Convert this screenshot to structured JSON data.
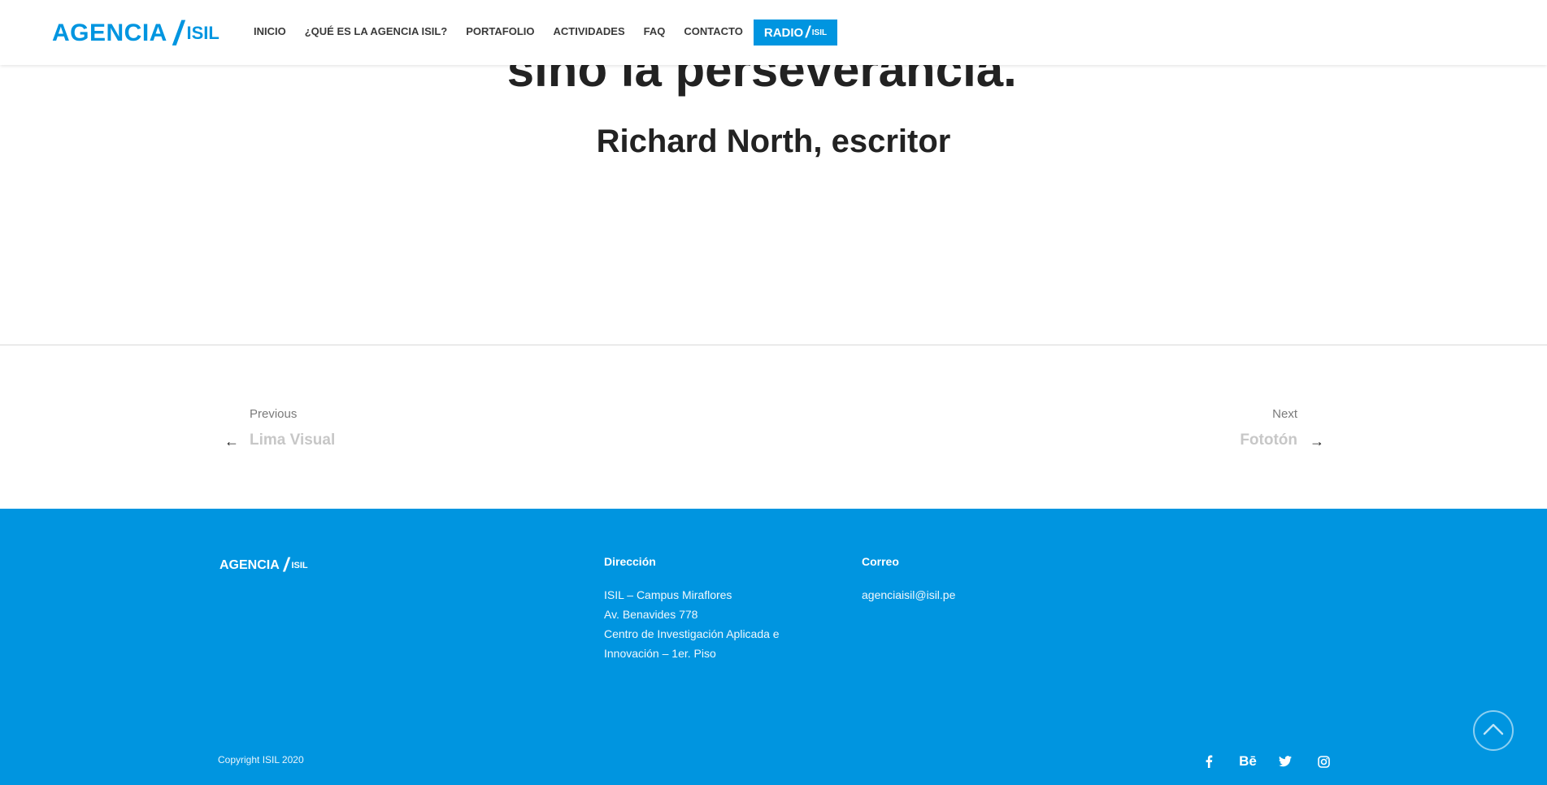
{
  "header": {
    "logo_word": "AGENCIA",
    "logo_slash": "/",
    "logo_isil": "ISIL",
    "nav": [
      "INICIO",
      "¿QUÉ ES LA AGENCIA ISIL?",
      "PORTAFOLIO",
      "ACTIVIDADES",
      "FAQ",
      "CONTACTO"
    ],
    "radio": {
      "word": "RADIO",
      "slash": "/",
      "isil": "ISIL"
    }
  },
  "quote": {
    "line": "sino la perseverancia.\"",
    "author": "Richard North, escritor"
  },
  "post_nav": {
    "prev_label": "Previous",
    "prev_title": "Lima Visual",
    "next_label": "Next",
    "next_title": "Fototón",
    "prev_arrow": "←",
    "next_arrow": "→"
  },
  "footer": {
    "logo_word": "AGENCIA",
    "logo_slash": "/",
    "logo_isil": "ISIL",
    "direccion_heading": "Dirección",
    "direccion_lines": [
      "ISIL – Campus Miraflores",
      "Av. Benavides 778",
      "Centro de Investigación Aplicada e",
      "Innovación – 1er. Piso"
    ],
    "correo_heading": "Correo",
    "correo_email": "agenciaisil@isil.pe",
    "copyright": "Copyright ISIL 2020",
    "social": [
      "facebook-icon",
      "behance-icon",
      "twitter-icon",
      "instagram-icon"
    ],
    "behance_text": "Bē"
  },
  "colors": {
    "brand": "#0095e0",
    "text": "#222222"
  }
}
